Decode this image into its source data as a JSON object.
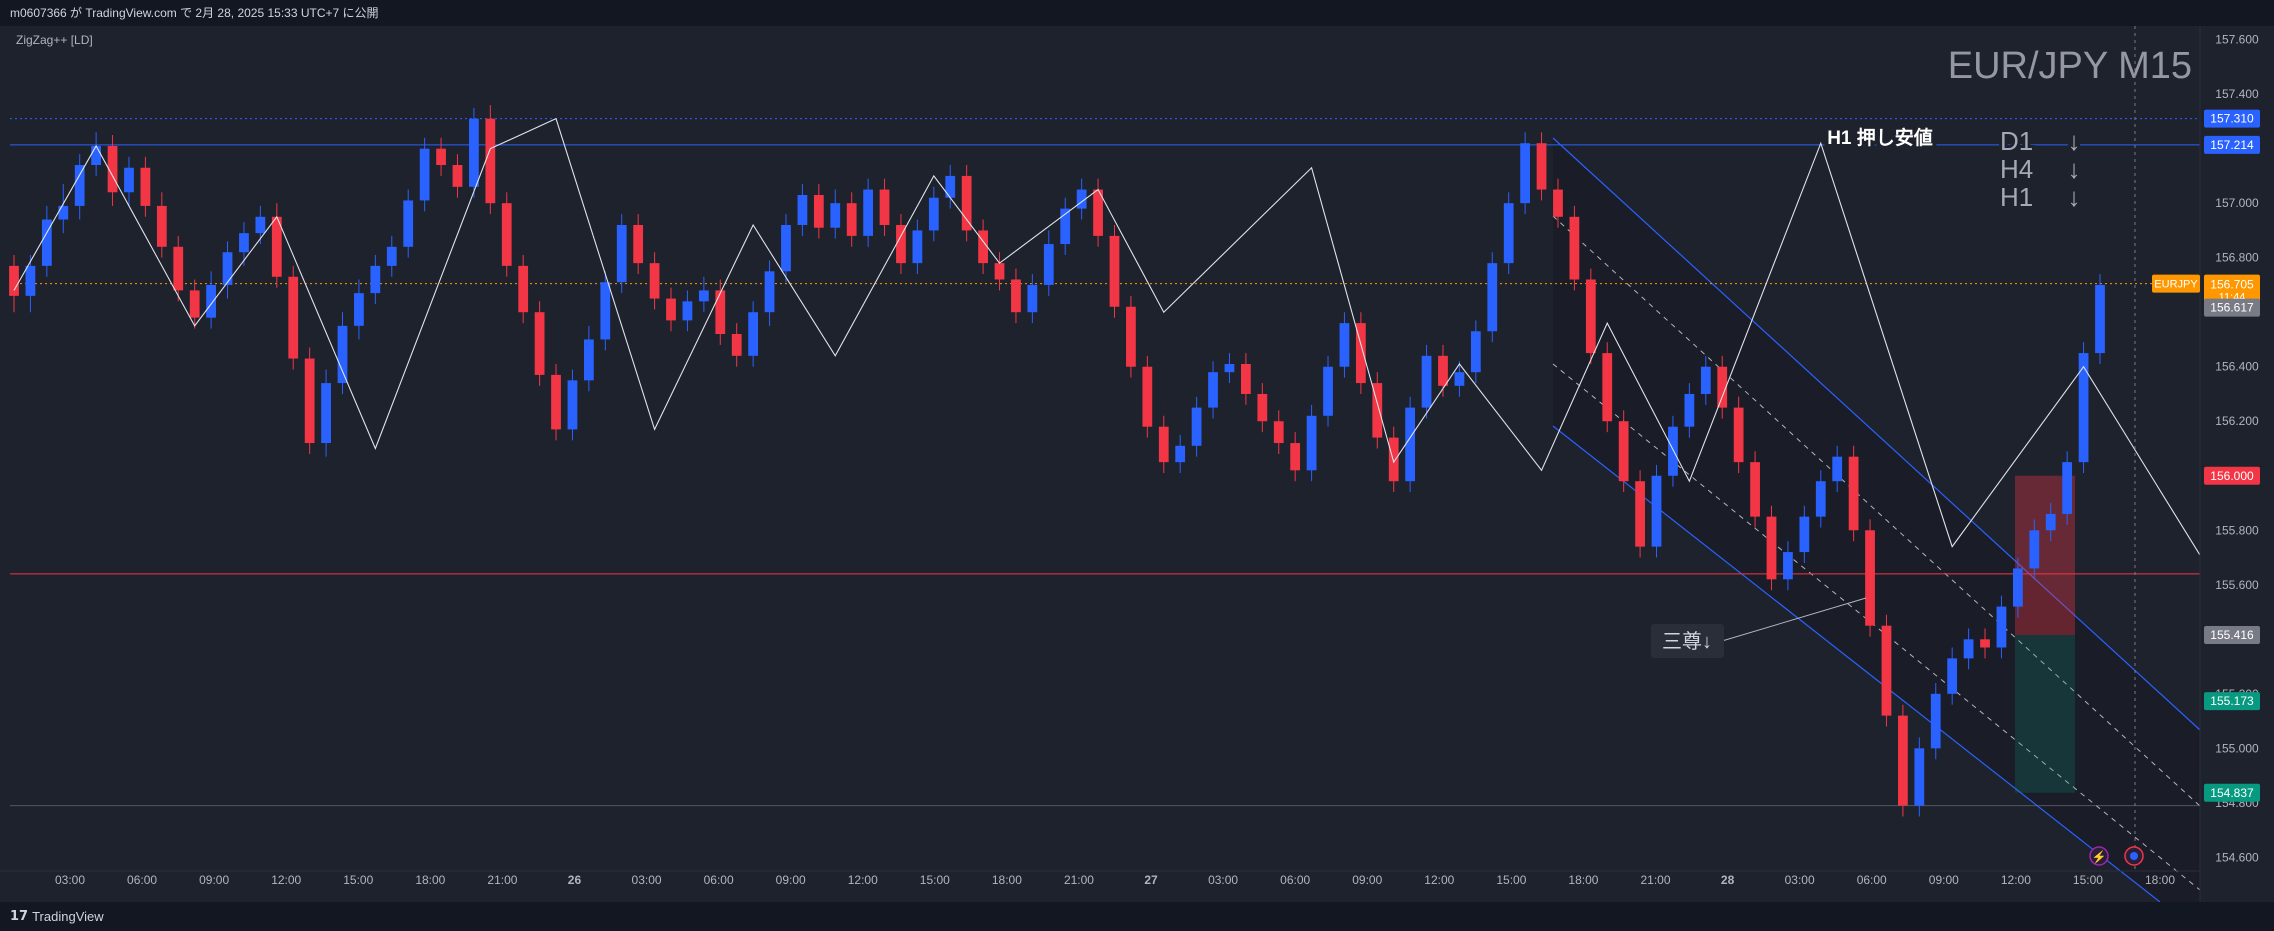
{
  "header": {
    "publish_text": "m0607366 が TradingView.com で 2月 28, 2025 15:33 UTC+7 に公開"
  },
  "footer": {
    "brand": "TradingView"
  },
  "indicator": {
    "label": "ZigZag++ [LD]"
  },
  "watermark": {
    "symbol_text": "EUR/JPY M15"
  },
  "annotations": {
    "h1_label": "H1 押し安値",
    "trend_d1": "D1",
    "trend_h4": "H4",
    "trend_h1": "H1",
    "trend_arrow": "↓",
    "pattern_label": "三尊↓"
  },
  "colors": {
    "background": "#1e222d",
    "bull": "#2962ff",
    "bear": "#f23645",
    "price_orange": "#ff9800",
    "label_blue": "#2962ff",
    "label_red": "#f23645",
    "label_green": "#089981",
    "label_gray": "#787b86"
  },
  "chart_data": {
    "type": "candlestick",
    "symbol": "EURJPY",
    "timeframe": "M15",
    "ylim": [
      154.55,
      157.65
    ],
    "y_ticks": [
      "157.600",
      "157.400",
      "157.200",
      "157.000",
      "156.800",
      "156.600",
      "156.400",
      "156.200",
      "156.000",
      "155.800",
      "155.600",
      "155.400",
      "155.200",
      "155.000",
      "154.800",
      "154.600"
    ],
    "x_ticks": [
      "03:00",
      "06:00",
      "09:00",
      "12:00",
      "15:00",
      "18:00",
      "21:00",
      "26",
      "03:00",
      "06:00",
      "09:00",
      "12:00",
      "15:00",
      "18:00",
      "21:00",
      "27",
      "03:00",
      "06:00",
      "09:00",
      "12:00",
      "15:00",
      "18:00",
      "21:00",
      "28",
      "03:00",
      "06:00",
      "09:00",
      "12:00",
      "15:00",
      "18:00"
    ],
    "price_labels": [
      {
        "value": 157.31,
        "text": "157.310",
        "color": "blue"
      },
      {
        "value": 157.214,
        "text": "157.214",
        "color": "blue"
      },
      {
        "value": 156.705,
        "text": "156.705",
        "color": "orange",
        "symbol": "EURJPY",
        "countdown": "11:44"
      },
      {
        "value": 156.617,
        "text": "156.617",
        "color": "gray"
      },
      {
        "value": 156.0,
        "text": "156.000",
        "color": "red"
      },
      {
        "value": 155.416,
        "text": "155.416",
        "color": "gray"
      },
      {
        "value": 155.173,
        "text": "155.173",
        "color": "green"
      },
      {
        "value": 154.837,
        "text": "154.837",
        "color": "green"
      }
    ],
    "horizontal_lines": [
      {
        "value": 157.31,
        "style": "dotted",
        "color": "blue"
      },
      {
        "value": 157.214,
        "style": "solid",
        "color": "blue"
      },
      {
        "value": 156.705,
        "style": "dotted",
        "color": "orange"
      },
      {
        "value": 155.64,
        "style": "solid",
        "color": "red"
      },
      {
        "value": 154.79,
        "style": "solid",
        "color": "gray"
      }
    ],
    "zigzag": [
      [
        0,
        156.68
      ],
      [
        5,
        157.21
      ],
      [
        11,
        156.55
      ],
      [
        16,
        156.95
      ],
      [
        22,
        156.1
      ],
      [
        29,
        157.2
      ],
      [
        33,
        157.31
      ],
      [
        39,
        156.17
      ],
      [
        45,
        156.92
      ],
      [
        50,
        156.44
      ],
      [
        56,
        157.1
      ],
      [
        60,
        156.78
      ],
      [
        66,
        157.05
      ],
      [
        70,
        156.6
      ],
      [
        79,
        157.13
      ],
      [
        84,
        156.05
      ],
      [
        88,
        156.41
      ],
      [
        93,
        156.02
      ],
      [
        97,
        156.56
      ],
      [
        102,
        155.98
      ],
      [
        110,
        157.22
      ],
      [
        118,
        155.74
      ],
      [
        126,
        156.4
      ],
      [
        134,
        155.62
      ],
      [
        137,
        156.07
      ],
      [
        142,
        154.79
      ],
      [
        153,
        156.7
      ]
    ],
    "candles": [
      [
        156.77,
        156.66,
        156.81,
        156.6
      ],
      [
        156.66,
        156.77,
        156.81,
        156.6
      ],
      [
        156.77,
        156.94,
        156.99,
        156.73
      ],
      [
        156.94,
        156.99,
        157.07,
        156.89
      ],
      [
        156.99,
        157.14,
        157.18,
        156.94
      ],
      [
        157.14,
        157.21,
        157.26,
        157.1
      ],
      [
        157.21,
        157.04,
        157.25,
        156.99
      ],
      [
        157.04,
        157.13,
        157.17,
        156.99
      ],
      [
        157.13,
        156.99,
        157.17,
        156.95
      ],
      [
        156.99,
        156.84,
        157.04,
        156.8
      ],
      [
        156.84,
        156.68,
        156.88,
        156.64
      ],
      [
        156.68,
        156.58,
        156.72,
        156.54
      ],
      [
        156.58,
        156.7,
        156.75,
        156.54
      ],
      [
        156.7,
        156.82,
        156.86,
        156.65
      ],
      [
        156.82,
        156.89,
        156.93,
        156.77
      ],
      [
        156.89,
        156.95,
        156.99,
        156.85
      ],
      [
        156.95,
        156.73,
        157.0,
        156.69
      ],
      [
        156.73,
        156.43,
        156.77,
        156.39
      ],
      [
        156.43,
        156.12,
        156.47,
        156.08
      ],
      [
        156.12,
        156.34,
        156.39,
        156.07
      ],
      [
        156.34,
        156.55,
        156.6,
        156.3
      ],
      [
        156.55,
        156.67,
        156.72,
        156.5
      ],
      [
        156.67,
        156.77,
        156.81,
        156.63
      ],
      [
        156.77,
        156.84,
        156.88,
        156.73
      ],
      [
        156.84,
        157.01,
        157.05,
        156.8
      ],
      [
        157.01,
        157.2,
        157.24,
        156.97
      ],
      [
        157.2,
        157.14,
        157.24,
        157.1
      ],
      [
        157.14,
        157.06,
        157.18,
        157.02
      ],
      [
        157.06,
        157.31,
        157.35,
        157.02
      ],
      [
        157.31,
        157.0,
        157.36,
        156.96
      ],
      [
        157.0,
        156.77,
        157.04,
        156.73
      ],
      [
        156.77,
        156.6,
        156.81,
        156.56
      ],
      [
        156.6,
        156.37,
        156.64,
        156.33
      ],
      [
        156.37,
        156.17,
        156.41,
        156.13
      ],
      [
        156.17,
        156.35,
        156.39,
        156.13
      ],
      [
        156.35,
        156.5,
        156.55,
        156.31
      ],
      [
        156.5,
        156.71,
        156.75,
        156.46
      ],
      [
        156.71,
        156.92,
        156.96,
        156.67
      ],
      [
        156.92,
        156.78,
        156.96,
        156.74
      ],
      [
        156.78,
        156.65,
        156.82,
        156.61
      ],
      [
        156.65,
        156.57,
        156.69,
        156.53
      ],
      [
        156.57,
        156.64,
        156.68,
        156.53
      ],
      [
        156.64,
        156.68,
        156.73,
        156.6
      ],
      [
        156.68,
        156.52,
        156.72,
        156.48
      ],
      [
        156.52,
        156.44,
        156.56,
        156.4
      ],
      [
        156.44,
        156.6,
        156.64,
        156.4
      ],
      [
        156.6,
        156.75,
        156.79,
        156.55
      ],
      [
        156.75,
        156.92,
        156.96,
        156.71
      ],
      [
        156.92,
        157.03,
        157.07,
        156.88
      ],
      [
        157.03,
        156.91,
        157.07,
        156.87
      ],
      [
        156.91,
        157.0,
        157.05,
        156.87
      ],
      [
        157.0,
        156.88,
        157.04,
        156.84
      ],
      [
        156.88,
        157.05,
        157.09,
        156.84
      ],
      [
        157.05,
        156.92,
        157.09,
        156.88
      ],
      [
        156.92,
        156.78,
        156.96,
        156.74
      ],
      [
        156.78,
        156.9,
        156.94,
        156.74
      ],
      [
        156.9,
        157.02,
        157.06,
        156.86
      ],
      [
        157.02,
        157.1,
        157.14,
        156.98
      ],
      [
        157.1,
        156.9,
        157.14,
        156.86
      ],
      [
        156.9,
        156.78,
        156.94,
        156.74
      ],
      [
        156.78,
        156.72,
        156.82,
        156.68
      ],
      [
        156.72,
        156.6,
        156.76,
        156.56
      ],
      [
        156.6,
        156.7,
        156.74,
        156.56
      ],
      [
        156.7,
        156.85,
        156.9,
        156.66
      ],
      [
        156.85,
        156.98,
        157.02,
        156.81
      ],
      [
        156.98,
        157.05,
        157.09,
        156.94
      ],
      [
        157.05,
        156.88,
        157.09,
        156.84
      ],
      [
        156.88,
        156.62,
        156.92,
        156.58
      ],
      [
        156.62,
        156.4,
        156.66,
        156.36
      ],
      [
        156.4,
        156.18,
        156.44,
        156.14
      ],
      [
        156.18,
        156.05,
        156.22,
        156.01
      ],
      [
        156.05,
        156.11,
        156.15,
        156.01
      ],
      [
        156.11,
        156.25,
        156.29,
        156.07
      ],
      [
        156.25,
        156.38,
        156.42,
        156.21
      ],
      [
        156.38,
        156.41,
        156.45,
        156.34
      ],
      [
        156.41,
        156.3,
        156.45,
        156.26
      ],
      [
        156.3,
        156.2,
        156.34,
        156.16
      ],
      [
        156.2,
        156.12,
        156.24,
        156.08
      ],
      [
        156.12,
        156.02,
        156.16,
        155.98
      ],
      [
        156.02,
        156.22,
        156.26,
        155.98
      ],
      [
        156.22,
        156.4,
        156.44,
        156.18
      ],
      [
        156.4,
        156.56,
        156.6,
        156.36
      ],
      [
        156.56,
        156.34,
        156.6,
        156.3
      ],
      [
        156.34,
        156.14,
        156.38,
        156.1
      ],
      [
        156.14,
        155.98,
        156.18,
        155.94
      ],
      [
        155.98,
        156.25,
        156.29,
        155.94
      ],
      [
        156.25,
        156.44,
        156.48,
        156.21
      ],
      [
        156.44,
        156.33,
        156.48,
        156.29
      ],
      [
        156.33,
        156.38,
        156.42,
        156.29
      ],
      [
        156.38,
        156.53,
        156.57,
        156.34
      ],
      [
        156.53,
        156.78,
        156.82,
        156.49
      ],
      [
        156.78,
        157.0,
        157.04,
        156.74
      ],
      [
        157.0,
        157.22,
        157.26,
        156.96
      ],
      [
        157.22,
        157.05,
        157.26,
        157.01
      ],
      [
        157.05,
        156.95,
        157.09,
        156.91
      ],
      [
        156.95,
        156.72,
        156.99,
        156.68
      ],
      [
        156.72,
        156.45,
        156.76,
        156.41
      ],
      [
        156.45,
        156.2,
        156.49,
        156.16
      ],
      [
        156.2,
        155.98,
        156.24,
        155.94
      ],
      [
        155.98,
        155.74,
        156.02,
        155.7
      ],
      [
        155.74,
        156.0,
        156.04,
        155.7
      ],
      [
        156.0,
        156.18,
        156.22,
        155.96
      ],
      [
        156.18,
        156.3,
        156.34,
        156.14
      ],
      [
        156.3,
        156.4,
        156.44,
        156.26
      ],
      [
        156.4,
        156.25,
        156.44,
        156.21
      ],
      [
        156.25,
        156.05,
        156.29,
        156.01
      ],
      [
        156.05,
        155.85,
        156.09,
        155.81
      ],
      [
        155.85,
        155.62,
        155.89,
        155.58
      ],
      [
        155.62,
        155.72,
        155.76,
        155.58
      ],
      [
        155.72,
        155.85,
        155.89,
        155.68
      ],
      [
        155.85,
        155.98,
        156.02,
        155.81
      ],
      [
        155.98,
        156.07,
        156.11,
        155.94
      ],
      [
        156.07,
        155.8,
        156.11,
        155.76
      ],
      [
        155.8,
        155.45,
        155.84,
        155.41
      ],
      [
        155.45,
        155.12,
        155.49,
        155.08
      ],
      [
        155.12,
        154.79,
        155.16,
        154.75
      ],
      [
        154.79,
        155.0,
        155.04,
        154.75
      ],
      [
        155.0,
        155.2,
        155.24,
        154.96
      ],
      [
        155.2,
        155.33,
        155.37,
        155.16
      ],
      [
        155.33,
        155.4,
        155.44,
        155.29
      ],
      [
        155.4,
        155.37,
        155.44,
        155.33
      ],
      [
        155.37,
        155.52,
        155.56,
        155.33
      ],
      [
        155.52,
        155.66,
        155.7,
        155.48
      ],
      [
        155.66,
        155.8,
        155.84,
        155.62
      ],
      [
        155.8,
        155.86,
        155.9,
        155.76
      ],
      [
        155.86,
        156.05,
        156.09,
        155.82
      ],
      [
        156.05,
        156.45,
        156.49,
        156.01
      ],
      [
        156.45,
        156.7,
        156.74,
        156.41
      ]
    ]
  }
}
